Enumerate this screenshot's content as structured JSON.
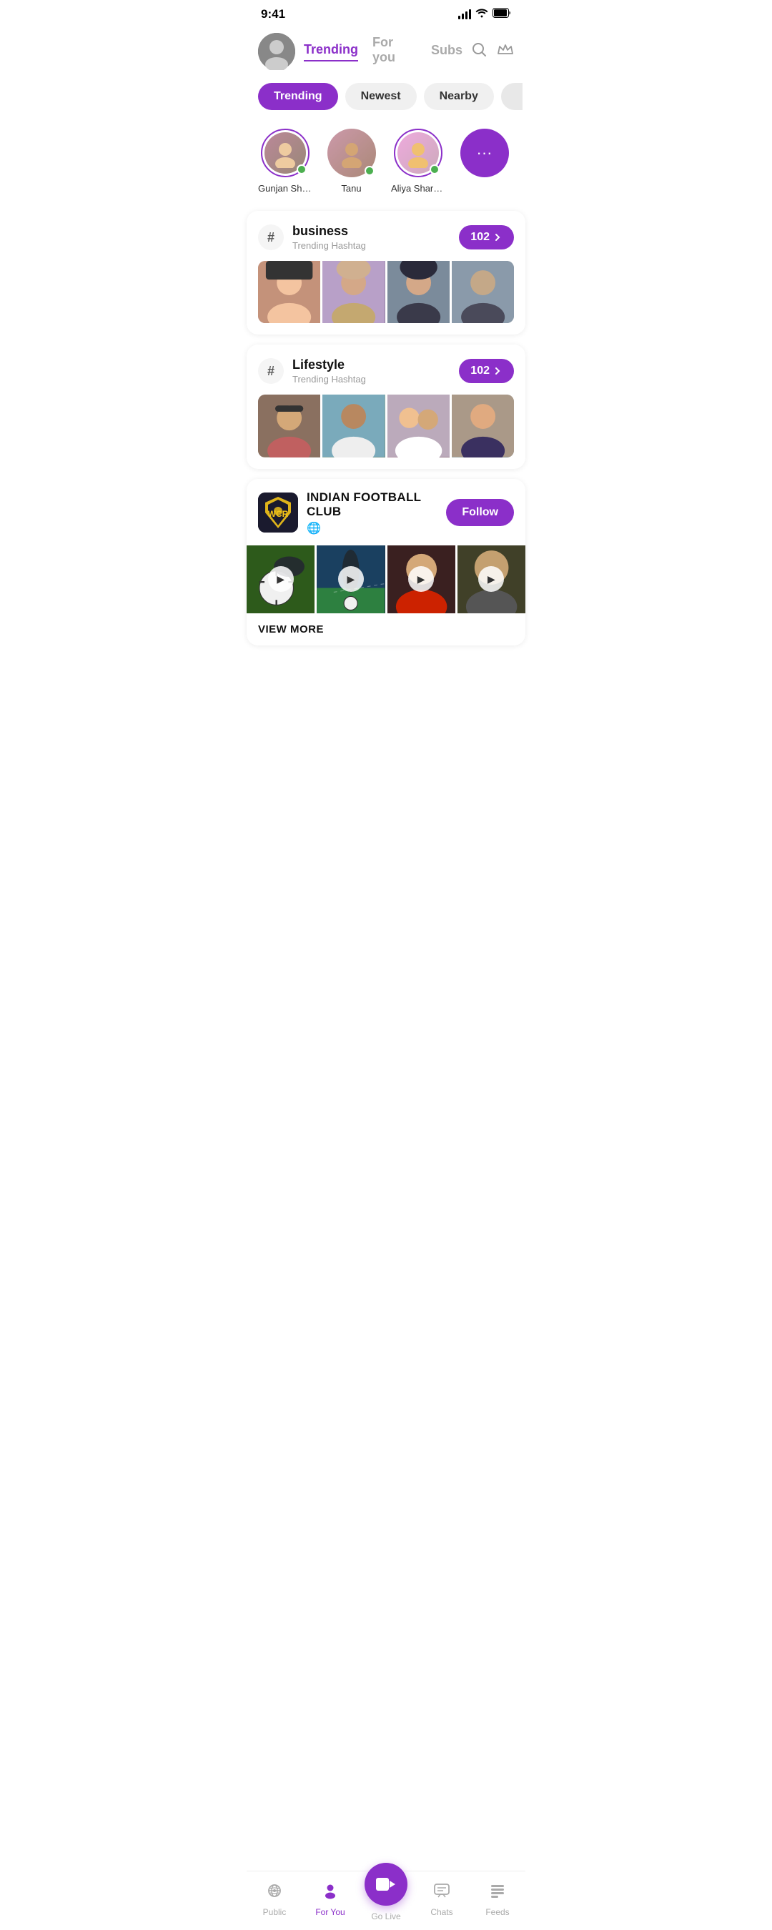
{
  "statusBar": {
    "time": "9:41",
    "signal": "●●●●",
    "wifi": "wifi",
    "battery": "battery"
  },
  "header": {
    "navTabs": [
      {
        "id": "trending",
        "label": "Trending",
        "active": true
      },
      {
        "id": "foryou",
        "label": "For you",
        "active": false
      },
      {
        "id": "subs",
        "label": "Subs",
        "active": false
      }
    ],
    "searchIcon": "search",
    "crownIcon": "crown"
  },
  "filterPills": [
    {
      "id": "trending",
      "label": "Trending",
      "active": true
    },
    {
      "id": "newest",
      "label": "Newest",
      "active": false
    },
    {
      "id": "nearby",
      "label": "Nearby",
      "active": false
    }
  ],
  "stories": [
    {
      "name": "Gunjan Sharma",
      "online": true,
      "hasRing": true,
      "emoji": "👩"
    },
    {
      "name": "Tanu",
      "online": true,
      "hasRing": false,
      "emoji": "👩‍🦱"
    },
    {
      "name": "Aliya Sharma",
      "online": true,
      "hasRing": true,
      "emoji": "👱‍♀️"
    },
    {
      "name": "More",
      "isMore": true,
      "emoji": "···"
    }
  ],
  "hashtags": [
    {
      "id": "business",
      "title": "business",
      "subtitle": "Trending Hashtag",
      "count": "102",
      "images": [
        {
          "colorClass": "person-1",
          "desc": "woman in beanie"
        },
        {
          "colorClass": "person-2",
          "desc": "woman in hijab pink"
        },
        {
          "colorClass": "person-3",
          "desc": "woman in hijab dark"
        },
        {
          "colorClass": "person-4",
          "desc": "partial view"
        }
      ]
    },
    {
      "id": "lifestyle",
      "title": "Lifestyle",
      "subtitle": "Trending Hashtag",
      "count": "102",
      "images": [
        {
          "colorClass": "person-5",
          "desc": "man with sunglasses"
        },
        {
          "colorClass": "person-6",
          "desc": "bald man at beach"
        },
        {
          "colorClass": "person-7",
          "desc": "two women smiling"
        },
        {
          "colorClass": "person-8",
          "desc": "partial view"
        }
      ]
    }
  ],
  "club": {
    "name": "INDIAN FOOTBALL CLUB",
    "logo": "🏆",
    "globeIcon": "🌐",
    "followLabel": "Follow",
    "videos": [
      {
        "colorClass": "football-1",
        "desc": "football on grass"
      },
      {
        "colorClass": "football-2",
        "desc": "player kicking"
      },
      {
        "colorClass": "football-3",
        "desc": "player portrait"
      },
      {
        "colorClass": "football-4",
        "desc": "player close up"
      }
    ],
    "viewMoreLabel": "VIEW MORE"
  },
  "bottomNav": [
    {
      "id": "public",
      "label": "Public",
      "icon": "📻",
      "active": false
    },
    {
      "id": "foryou",
      "label": "For You",
      "icon": "👤",
      "active": true
    },
    {
      "id": "golive",
      "label": "Go Live",
      "icon": "🎬",
      "isCenter": true
    },
    {
      "id": "chats",
      "label": "Chats",
      "icon": "💬",
      "active": false
    },
    {
      "id": "feeds",
      "label": "Feeds",
      "icon": "≡",
      "active": false
    }
  ]
}
